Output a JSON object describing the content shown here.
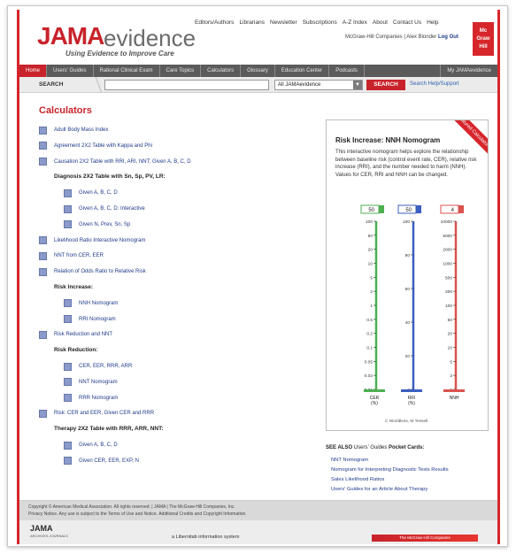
{
  "header": {
    "logo_jama": "JAMA",
    "logo_evidence": "evidence",
    "tagline": "Using Evidence to Improve Care",
    "top_links": [
      "Editors/Authors",
      "Librarians",
      "Newsletter",
      "Subscriptions",
      "A-Z Index",
      "About",
      "Contact Us",
      "Help"
    ],
    "company_text": "McGraw-Hill Companies  |  Alex Blonder",
    "logout": "Log Out",
    "mgh_logo": "Mc Graw Hill"
  },
  "nav": {
    "tabs": [
      "Home",
      "Users' Guides",
      "Rational Clinical Exam",
      "Care Topics",
      "Calculators",
      "Glossary",
      "Education Center",
      "Podcasts",
      "My JAMAevidence"
    ]
  },
  "search": {
    "label": "SEARCH",
    "value": "",
    "scope": "All JAMAevidence",
    "button": "SEARCH",
    "help": "Search Help/Support"
  },
  "calculators": {
    "title": "Calculators",
    "items": [
      {
        "type": "link",
        "level": 0,
        "label": "Adult Body Mass Index"
      },
      {
        "type": "link",
        "level": 0,
        "label": "Agreement 2X2 Table with Kappa and Phi"
      },
      {
        "type": "link",
        "level": 0,
        "label": "Causation 2X2 Table with RRI, ARI, NNT; Given A, B, C, D"
      },
      {
        "type": "heading",
        "level": 1,
        "label": "Diagnosis 2X2 Table with Sn, Sp, PV, LR:"
      },
      {
        "type": "link",
        "level": 1,
        "label": "Given A, B, C, D"
      },
      {
        "type": "link",
        "level": 1,
        "label": "Given A, B, C, D: Interactive"
      },
      {
        "type": "link",
        "level": 1,
        "label": "Given N, Prev, Sn, Sp"
      },
      {
        "type": "link",
        "level": 0,
        "label": "Likelihood Ratio Interactive Nomogram"
      },
      {
        "type": "link",
        "level": 0,
        "label": "NNT from CER, EER"
      },
      {
        "type": "link",
        "level": 0,
        "label": "Relation of Odds Ratio to Relative Risk"
      },
      {
        "type": "heading",
        "level": 1,
        "label": "Risk Increase:"
      },
      {
        "type": "link",
        "level": 1,
        "label": "NNH Nomogram"
      },
      {
        "type": "link",
        "level": 1,
        "label": "RRI Nomogram"
      },
      {
        "type": "link",
        "level": 0,
        "label": "Risk Reduction and NNT"
      },
      {
        "type": "heading",
        "level": 1,
        "label": "Risk Reduction:"
      },
      {
        "type": "link",
        "level": 1,
        "label": "CER, EER, RRR, ARR"
      },
      {
        "type": "link",
        "level": 1,
        "label": "NNT Nomogram"
      },
      {
        "type": "link",
        "level": 1,
        "label": "RRR Nomogram"
      },
      {
        "type": "link",
        "level": 0,
        "label": "Risk: CER and EER, Given CER and RRR"
      },
      {
        "type": "heading",
        "level": 1,
        "label": "Therapy 2X2 Table with RRR, ARR, NNT:"
      },
      {
        "type": "link",
        "level": 1,
        "label": "Given A, B, C, D"
      },
      {
        "type": "link",
        "level": 1,
        "label": "Given CER, EER, EXP, N"
      }
    ]
  },
  "panel": {
    "ribbon": "Featured Calculator",
    "title": "Risk Increase: NNH Nomogram",
    "description": "This interactive nomogram helps explore the relationship between baseline risk (control event rate, CER), relative risk increase (RRI), and the number needed to harm (NNH). Values for CER, RRI and NNH can be changed.",
    "caption": "C Worldless, M Tessell",
    "nomogram": {
      "scales": [
        {
          "name": "CER",
          "unit": "(%)",
          "value": "50",
          "color": "#4caf50",
          "ticks": [
            "100",
            "50",
            "20",
            "10",
            "5",
            "2",
            "1",
            "0.5",
            "0.2",
            "0.1",
            "0.05",
            "0.02",
            "0.01"
          ]
        },
        {
          "name": "RRI",
          "unit": "(%)",
          "value": "50",
          "color": "#3b5fc0",
          "ticks": [
            "100",
            "80",
            "60",
            "40",
            "20",
            "0"
          ]
        },
        {
          "name": "NNH",
          "unit": "",
          "value": "4",
          "color": "#d9534f",
          "ticks": [
            "10000",
            "5000",
            "2000",
            "1000",
            "500",
            "200",
            "100",
            "50",
            "20",
            "10",
            "5",
            "2",
            "1"
          ]
        }
      ]
    }
  },
  "see_also": {
    "title_prefix": "SEE ALSO",
    "title_italic": "Users' Guides",
    "title_suffix": "Pocket Cards:",
    "links": [
      "NNT Nomogram",
      "Nomogram for Interpreting Diagnostic Tests Results",
      "Sales Likelihood Ratios",
      "Users' Guides for an Article About Therapy"
    ]
  },
  "footer": {
    "copyright": "Copyright © American Medical Association. All rights reserved.  |  JAMA  |  The McGraw-Hill Companies, Inc.",
    "privacy": "Privacy Notice. Any use is subject to the Terms of Use and Notice. Additional Credits and Copyright Information.",
    "logo": "JAMA",
    "logo_sub": "ARCHIVES JOURNALS",
    "network": "a Libernitab information system",
    "mgh": "The McGraw-Hill Companies"
  },
  "colors": {
    "brand_red": "#c8232b",
    "link_blue": "#1f3a8a",
    "nav_gray": "#5b5b5b"
  }
}
